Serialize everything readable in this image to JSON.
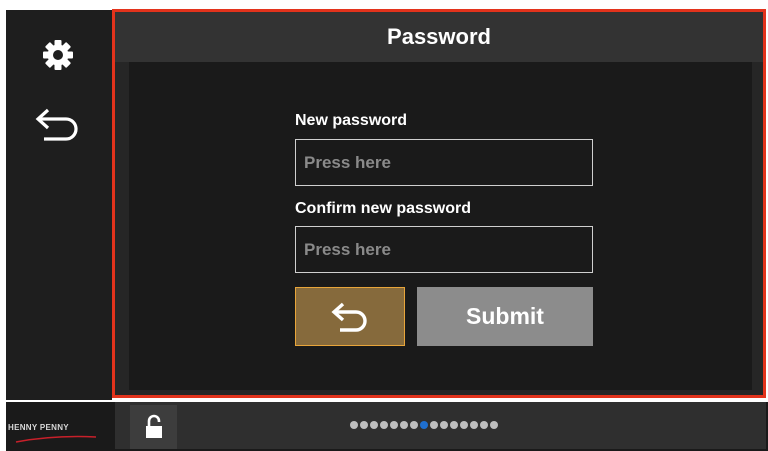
{
  "panel": {
    "title": "Password",
    "new_password": {
      "label": "New password",
      "placeholder": "Press here"
    },
    "confirm_password": {
      "label": "Confirm new password",
      "placeholder": "Press here"
    },
    "buttons": {
      "back_icon": "undo-arrow-icon",
      "submit_label": "Submit"
    }
  },
  "sidebar": {
    "items": [
      {
        "icon": "gear-icon"
      },
      {
        "icon": "undo-arrow-icon"
      }
    ]
  },
  "footer": {
    "logo_text": "HENNY PENNY",
    "lock_icon": "unlock-icon",
    "page_indicator": {
      "total": 15,
      "active_index": 7
    }
  },
  "colors": {
    "highlight_border": "#e3331c",
    "back_button_fill": "#866a3c",
    "back_button_border": "#e8a53a",
    "active_dot": "#1f6fcf",
    "submit_fill": "#8c8c8c"
  }
}
